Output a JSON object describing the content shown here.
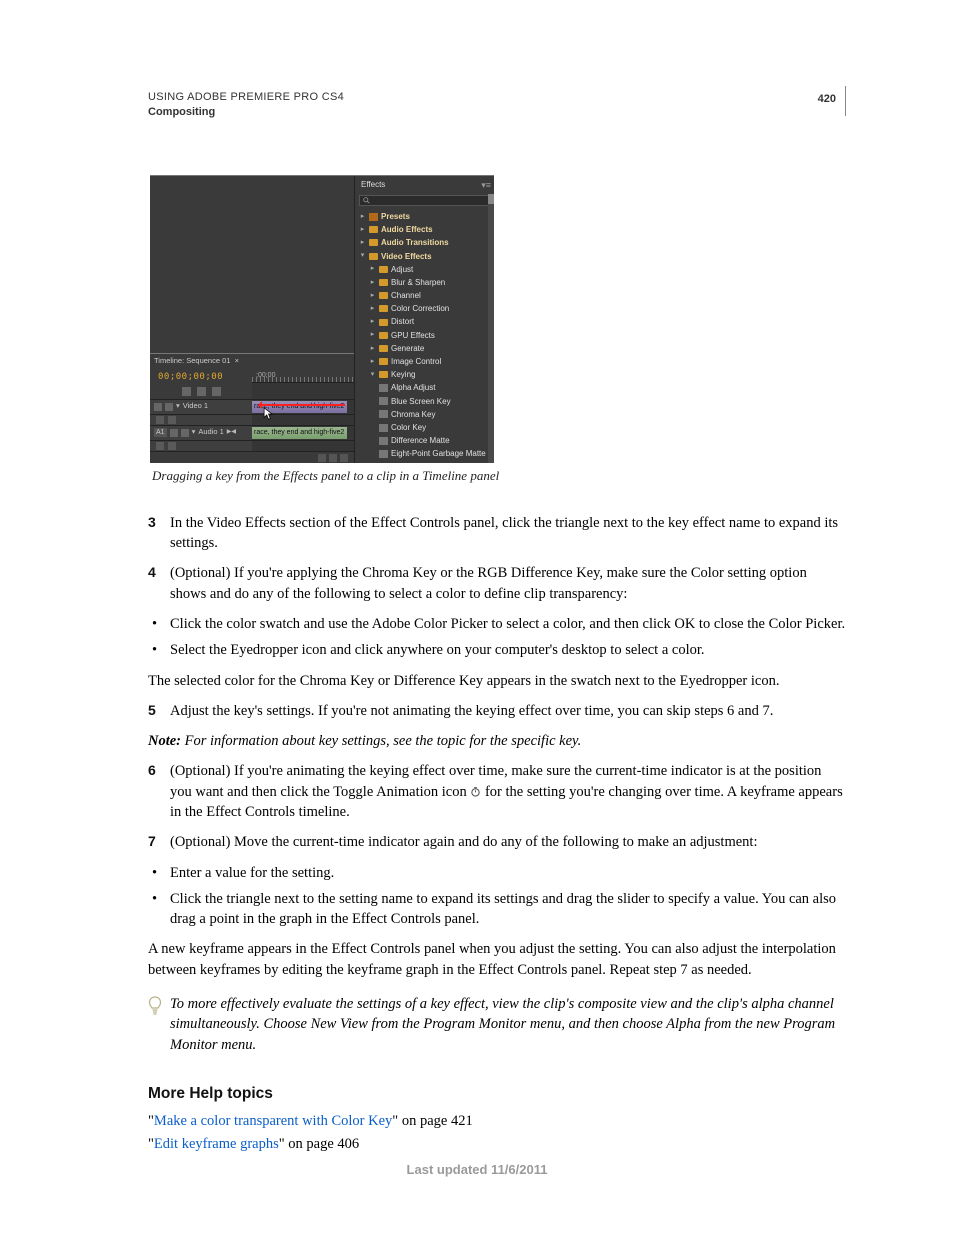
{
  "header": {
    "product_line": "USING ADOBE PREMIERE PRO CS4",
    "chapter": "Compositing",
    "page_number": "420"
  },
  "figure": {
    "caption": "Dragging a key from the Effects panel to a clip in a Timeline panel",
    "effects_panel": {
      "tab": "Effects",
      "menu_glyph": "▾≡",
      "tree": {
        "presets": "Presets",
        "audio_effects": "Audio Effects",
        "audio_transitions": "Audio Transitions",
        "video_effects": "Video Effects",
        "video_effects_children": {
          "adjust": "Adjust",
          "blur_sharpen": "Blur & Sharpen",
          "channel": "Channel",
          "color_correction": "Color Correction",
          "distort": "Distort",
          "gpu_effects": "GPU Effects",
          "generate": "Generate",
          "image_control": "Image Control",
          "keying": "Keying",
          "keying_children": {
            "alpha_adjust": "Alpha Adjust",
            "blue_screen_key": "Blue Screen Key",
            "chroma_key": "Chroma Key",
            "color_key": "Color Key",
            "difference_matte": "Difference Matte",
            "eight_point": "Eight-Point Garbage Matte"
          }
        }
      }
    },
    "timeline_panel": {
      "tab": "Timeline: Sequence 01",
      "timecode": "00;00;00;00",
      "ruler_label": ";00;00",
      "video_track_label": "Video 1",
      "audio_track_label": "Audio 1",
      "audio_track_badge": "A1",
      "clip_label_video": "race, they end and high-five2",
      "clip_label_audio": "race, they end and high-five2"
    }
  },
  "steps": {
    "s3": "In the Video Effects section of the Effect Controls panel, click the triangle next to the key effect name to expand its settings.",
    "s4": "(Optional) If you're applying the Chroma Key or the RGB Difference Key, make sure the Color setting option shows and do any of the following to select a color to define clip transparency:",
    "s4_b1": "Click the color swatch and use the Adobe Color Picker to select a color, and then click OK to close the Color Picker.",
    "s4_b2": "Select the Eyedropper icon and click anywhere on your computer's desktop to select a color.",
    "s4_post": "The selected color for the Chroma Key or Difference Key appears in the swatch next to the Eyedropper icon.",
    "s5": "Adjust the key's settings. If you're not animating the keying effect over time, you can skip steps 6 and 7.",
    "note_label": "Note:",
    "note_body": " For information about key settings, see the topic for the specific key.",
    "s6_a": "(Optional) If you're animating the keying effect over time, make sure the current-time indicator is at the position you want and then click the Toggle Animation icon ",
    "s6_b": " for the setting you're changing over time. A keyframe appears in the Effect Controls timeline.",
    "s7": "(Optional) Move the current-time indicator again and do any of the following to make an adjustment:",
    "s7_b1": "Enter a value for the setting.",
    "s7_b2": "Click the triangle next to the setting name to expand its settings and drag the slider to specify a value. You can also drag a point in the graph in the Effect Controls panel.",
    "s7_post": "A new keyframe appears in the Effect Controls panel when you adjust the setting. You can also adjust the interpolation between keyframes by editing the keyframe graph in the Effect Controls panel. Repeat step 7 as needed."
  },
  "tip": {
    "line": "To more effectively evaluate the settings of a key effect, view the clip's composite view and the clip's alpha channel simultaneously. Choose New View from the Program Monitor menu, and then choose Alpha from the new Program Monitor menu."
  },
  "more_help": {
    "heading": "More Help topics",
    "items": [
      {
        "q1": "\"",
        "link": "Make a color transparent with Color Key",
        "q2": "\" on page 421"
      },
      {
        "q1": "\"",
        "link": "Edit keyframe graphs",
        "q2": "\" on page 406"
      }
    ]
  },
  "footer": {
    "updated": "Last updated 11/6/2011"
  },
  "nums": {
    "n3": "3",
    "n4": "4",
    "n5": "5",
    "n6": "6",
    "n7": "7"
  },
  "bullet_glyph": "•"
}
